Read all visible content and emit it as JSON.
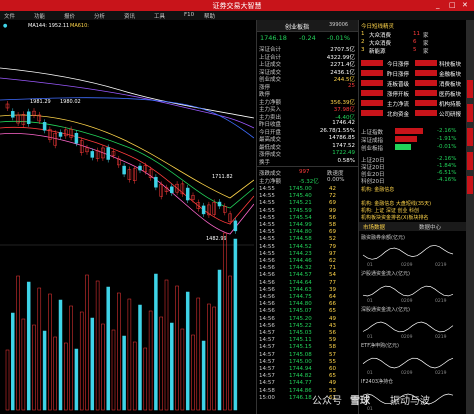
{
  "window": {
    "title": "证券交易大智慧",
    "controls": [
      "_",
      "□",
      "✕"
    ]
  },
  "menu": [
    "文件",
    "功能",
    "报价",
    "分析",
    "资讯",
    "工具",
    "F10",
    "帮助"
  ],
  "chart": {
    "ma_legend": [
      {
        "label": "MA144: 1952.11",
        "color": "#ffffff"
      },
      {
        "label": "MA610:",
        "color": "#ffd54a"
      }
    ],
    "labels": {
      "top_left_level": "1981.29",
      "top_right_level": "1980.02",
      "last_price": "1711.82",
      "low_price": "1482.99"
    },
    "volume_label": "VOL"
  },
  "index": {
    "name": "创业板指",
    "code": "399006",
    "price": "1746.18",
    "change": "-0.24",
    "change_pct": "-0.01%"
  },
  "stats": [
    {
      "k": "深证合计",
      "v": "2707.5亿",
      "c": "#ffffff"
    },
    {
      "k": "上证合计",
      "v": "4322.99亿",
      "c": "#ffffff"
    },
    {
      "k": "上证成交",
      "v": "2271.4亿",
      "c": "#ffffff"
    },
    {
      "k": "深证成交",
      "v": "2436.1亿",
      "c": "#ffffff"
    },
    {
      "k": "创业成交",
      "v": "244.5亿",
      "c": "#ffd54a"
    },
    {
      "k": "涨停",
      "v": "25",
      "c": "#ff3b3b"
    },
    {
      "k": "跌停",
      "v": "",
      "c": "#ff3b3b"
    },
    {
      "k": "主力净额",
      "v": "356.39亿",
      "c": "#ffd54a"
    },
    {
      "k": "主力买入",
      "v": "37.98亿",
      "c": "#ff3b3b"
    },
    {
      "k": "主力卖出",
      "v": "-4.40亿",
      "c": "#22d35a"
    },
    {
      "k": "昨日收盘",
      "v": "1746.42",
      "c": "#ffffff"
    },
    {
      "k": "今日开盘",
      "v": "26.78/1.55%",
      "c": "#ffffff"
    },
    {
      "k": "最高成交",
      "v": "14786.85",
      "c": "#ffffff"
    },
    {
      "k": "最低成交",
      "v": "1747.52",
      "c": "#ffffff"
    },
    {
      "k": "涨停成交",
      "v": "1722.49",
      "c": "#22d35a"
    },
    {
      "k": "换手",
      "v": "0.58%",
      "c": "#ffffff"
    }
  ],
  "trade_header": {
    "left": "涨跌成交",
    "mid": "997",
    "right": "跌速度"
  },
  "trade_sub": {
    "left": "主力净额",
    "mid": "-5.32亿",
    "right": "0.00%"
  },
  "ticks": [
    {
      "t": "14:55",
      "p": "1745.00",
      "v": "42"
    },
    {
      "t": "14:55",
      "p": "1745.40",
      "v": "72"
    },
    {
      "t": "14:55",
      "p": "1745.21",
      "v": "69"
    },
    {
      "t": "14:55",
      "p": "1745.59",
      "v": "99"
    },
    {
      "t": "14:55",
      "p": "1745.54",
      "v": "56"
    },
    {
      "t": "14:55",
      "p": "1744.99",
      "v": "58"
    },
    {
      "t": "14:55",
      "p": "1744.80",
      "v": "69"
    },
    {
      "t": "14:55",
      "p": "1744.58",
      "v": "52"
    },
    {
      "t": "14:55",
      "p": "1744.52",
      "v": "79"
    },
    {
      "t": "14:55",
      "p": "1744.23",
      "v": "97"
    },
    {
      "t": "14:56",
      "p": "1744.46",
      "v": "62"
    },
    {
      "t": "14:56",
      "p": "1744.32",
      "v": "71"
    },
    {
      "t": "14:56",
      "p": "1744.57",
      "v": "54"
    },
    {
      "t": "14:56",
      "p": "1744.64",
      "v": "77"
    },
    {
      "t": "14:56",
      "p": "1744.63",
      "v": "39"
    },
    {
      "t": "14:56",
      "p": "1744.75",
      "v": "64"
    },
    {
      "t": "14:56",
      "p": "1744.80",
      "v": "66"
    },
    {
      "t": "14:56",
      "p": "1745.07",
      "v": "65"
    },
    {
      "t": "14:56",
      "p": "1745.20",
      "v": "49"
    },
    {
      "t": "14:56",
      "p": "1745.22",
      "v": "43"
    },
    {
      "t": "14:57",
      "p": "1745.03",
      "v": "56"
    },
    {
      "t": "14:57",
      "p": "1745.11",
      "v": "59"
    },
    {
      "t": "14:57",
      "p": "1745.15",
      "v": "58"
    },
    {
      "t": "14:57",
      "p": "1745.08",
      "v": "57"
    },
    {
      "t": "14:57",
      "p": "1745.00",
      "v": "55"
    },
    {
      "t": "14:57",
      "p": "1744.94",
      "v": "60"
    },
    {
      "t": "14:57",
      "p": "1744.82",
      "v": "65"
    },
    {
      "t": "14:57",
      "p": "1744.77",
      "v": "49"
    },
    {
      "t": "14:58",
      "p": "1744.86",
      "v": "53"
    },
    {
      "t": "15:00",
      "p": "1746.18",
      "v": "61"
    }
  ],
  "right": {
    "title": "今日短线精灵",
    "rows": [
      {
        "a": "1",
        "b": "大众消费",
        "c": "11",
        "d": "家"
      },
      {
        "a": "2",
        "b": "大众消费",
        "c": "6",
        "d": "家"
      },
      {
        "a": "3",
        "b": "新能源",
        "c": "5",
        "d": "家"
      }
    ],
    "tags": [
      {
        "l": "今日涨停",
        "r": "科技板块"
      },
      {
        "l": "昨日涨停",
        "r": "金融板块"
      },
      {
        "l": "连板晋级",
        "r": "消费板块"
      },
      {
        "l": "涨停开板",
        "r": "医药板块"
      },
      {
        "l": "主力净流",
        "r": "机构持股"
      },
      {
        "l": "北向资金",
        "r": "公司研报"
      }
    ],
    "bars": [
      {
        "label": "上证指数",
        "val": "-2.16%"
      },
      {
        "label": "深证成指",
        "val": "-1.91%"
      },
      {
        "label": "创业板指",
        "val": "-0.01%"
      }
    ],
    "mini": [
      {
        "l": "上证20日",
        "v": "-2.16%"
      },
      {
        "l": "深证20日",
        "v": "-1.84%"
      },
      {
        "l": "创业20日",
        "v": "-6.51%"
      },
      {
        "l": "科创20日",
        "v": "-4.16%"
      }
    ],
    "notes": [
      "机构: 金融信息",
      "",
      "机构: 金融信息  大盘短线(35天)",
      "机构: 上证 深证 创业 科创",
      "机构板块资金排名(X)板块排名"
    ],
    "section2": "市场数据",
    "section2_right": "数据中心",
    "charts": [
      {
        "title": "融资融券余额(亿元)",
        "x": [
          "01",
          "0209",
          "0219"
        ]
      },
      {
        "title": "沪股通资金流入(亿元)",
        "x": [
          "01",
          "0209",
          "0219"
        ]
      },
      {
        "title": "深股通资金流入(亿元)",
        "x": [
          "01",
          "0209",
          "0219"
        ]
      },
      {
        "title": "ETF净申购(亿元)",
        "x": [
          "01",
          "0209",
          "0219"
        ]
      },
      {
        "title": "IF2403净持仓",
        "x": [
          "01"
        ]
      }
    ]
  },
  "watermark": {
    "prefix": "公众号",
    "brand": "雪球",
    "author": "振动与波"
  },
  "colors": {
    "up": "#ff3b3b",
    "down": "#22d35a",
    "accent": "#c8141a",
    "yellow": "#ffd54a",
    "cyan": "#3fd4e8"
  }
}
